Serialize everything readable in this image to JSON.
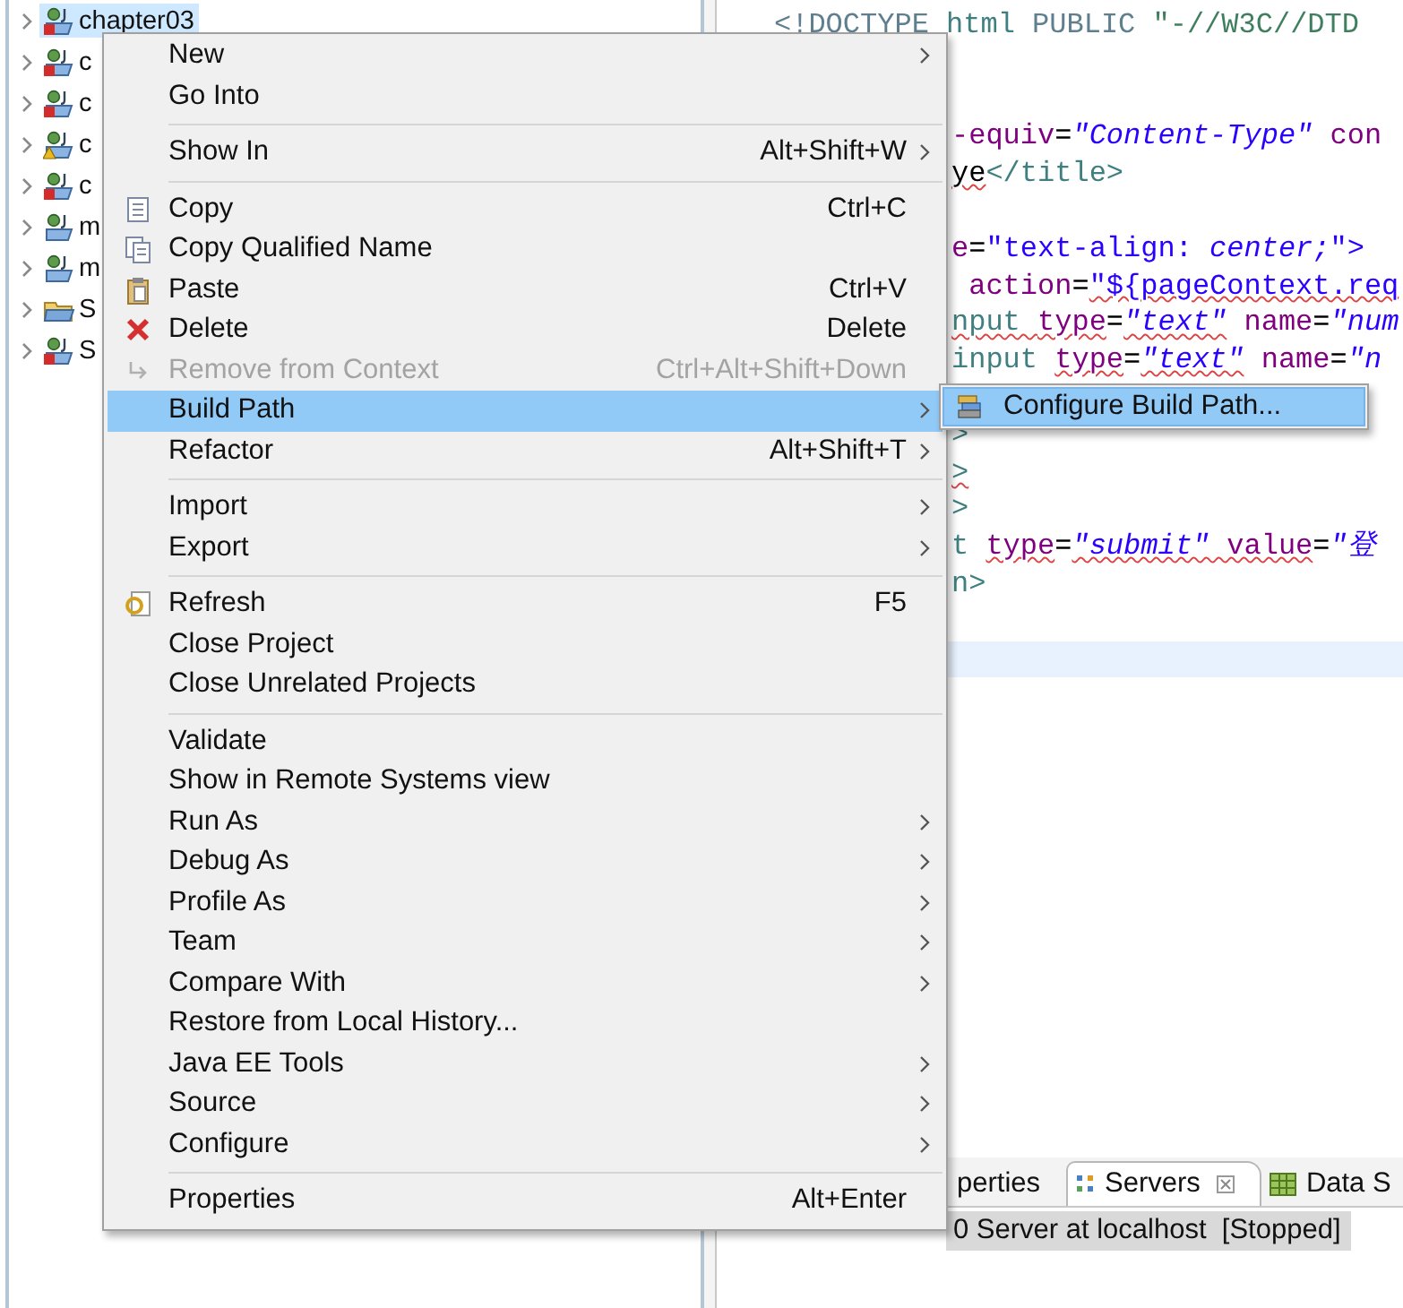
{
  "explorer": {
    "items": [
      {
        "label": "chapter03",
        "selected": true,
        "kind": "error"
      },
      {
        "label": "c",
        "selected": false,
        "kind": "error"
      },
      {
        "label": "c",
        "selected": false,
        "kind": "error"
      },
      {
        "label": "c",
        "selected": false,
        "kind": "warning"
      },
      {
        "label": "c",
        "selected": false,
        "kind": "error"
      },
      {
        "label": "m",
        "selected": false,
        "kind": "plain"
      },
      {
        "label": "m",
        "selected": false,
        "kind": "plain"
      },
      {
        "label": "S",
        "selected": false,
        "kind": "folder"
      },
      {
        "label": "S",
        "selected": false,
        "kind": "error"
      }
    ]
  },
  "editor": {
    "lines": [
      {
        "kind": "full",
        "segments": [
          {
            "t": "<!DOCTYPE",
            "kind": "decl"
          },
          {
            "t": " html ",
            "kind": "tag"
          },
          {
            "t": "PUBLIC ",
            "kind": "decl"
          },
          {
            "t": "\"-//W3C//DTD",
            "kind": "doc"
          }
        ]
      },
      {
        "kind": "hidden"
      },
      {
        "kind": "hidden"
      },
      {
        "kind": "partial",
        "segments": [
          {
            "t": "-equiv",
            "kind": "attr"
          },
          {
            "t": "=",
            "kind": "plain"
          },
          {
            "t": "\"Content-Type\"",
            "kind": "val"
          },
          {
            "t": " con",
            "kind": "attr"
          }
        ]
      },
      {
        "kind": "partial",
        "segments": [
          {
            "t": "ye",
            "kind": "plain",
            "misspelled": true
          },
          {
            "t": "</title>",
            "kind": "tag"
          }
        ]
      },
      {
        "kind": "hidden"
      },
      {
        "kind": "partial",
        "segments": [
          {
            "t": "e",
            "kind": "attr"
          },
          {
            "t": "=",
            "kind": "plain"
          },
          {
            "t": "\"text-align: ",
            "kind": "str"
          },
          {
            "t": "center;",
            "kind": "val"
          },
          {
            "t": "\">",
            "kind": "str"
          }
        ]
      },
      {
        "kind": "partial",
        "segments": [
          {
            "t": " action",
            "kind": "attr"
          },
          {
            "t": "=",
            "kind": "plain"
          },
          {
            "t": "\"${pageContext.req",
            "kind": "str",
            "misspelled": true
          }
        ]
      },
      {
        "kind": "partial",
        "segments": [
          {
            "t": "nput ",
            "kind": "tag",
            "misspelled": true
          },
          {
            "t": "type",
            "kind": "attr",
            "misspelled": true
          },
          {
            "t": "=",
            "kind": "plain"
          },
          {
            "t": "\"text\"",
            "kind": "val",
            "misspelled": true
          },
          {
            "t": " name",
            "kind": "attr"
          },
          {
            "t": "=",
            "kind": "plain"
          },
          {
            "t": "\"num",
            "kind": "val"
          }
        ]
      },
      {
        "kind": "partial",
        "segments": [
          {
            "t": "input ",
            "kind": "tag"
          },
          {
            "t": "type",
            "kind": "attr",
            "misspelled": true
          },
          {
            "t": "=",
            "kind": "plain"
          },
          {
            "t": "\"text\"",
            "kind": "val",
            "misspelled": true
          },
          {
            "t": " name",
            "kind": "attr"
          },
          {
            "t": "=",
            "kind": "plain"
          },
          {
            "t": "\"n",
            "kind": "val"
          }
        ]
      },
      {
        "kind": "hidden"
      },
      {
        "kind": "partial",
        "segments": [
          {
            "t": ">",
            "kind": "tag"
          }
        ]
      },
      {
        "kind": "partial",
        "segments": [
          {
            "t": ">",
            "kind": "tag",
            "misspelled": true
          }
        ]
      },
      {
        "kind": "partial",
        "segments": [
          {
            "t": ">",
            "kind": "tag"
          }
        ]
      },
      {
        "kind": "partial",
        "segments": [
          {
            "t": "t ",
            "kind": "tag"
          },
          {
            "t": "type",
            "kind": "attr",
            "misspelled": true
          },
          {
            "t": "=",
            "kind": "plain"
          },
          {
            "t": "\"submit\"",
            "kind": "val",
            "misspelled": true
          },
          {
            "t": " value",
            "kind": "attr",
            "misspelled": true
          },
          {
            "t": "=",
            "kind": "plain"
          },
          {
            "t": "\"登",
            "kind": "val"
          }
        ]
      },
      {
        "kind": "partial",
        "segments": [
          {
            "t": "n>",
            "kind": "tag"
          }
        ]
      },
      {
        "kind": "hidden"
      },
      {
        "kind": "current"
      }
    ]
  },
  "bottom_panel": {
    "tabs": [
      {
        "label": "perties",
        "selected": false,
        "kind": "cut"
      },
      {
        "label": "Servers",
        "selected": true,
        "kind": "servers"
      },
      {
        "label": "Data S",
        "selected": false,
        "kind": "data"
      }
    ],
    "rows": [
      {
        "label": "0 Server at localhost  [Stopped]",
        "selected": true
      }
    ]
  },
  "context_menu": {
    "groups": [
      [
        {
          "label": "New",
          "kind": "plain",
          "submenu": true,
          "disabled": false,
          "selected": false
        },
        {
          "label": "Go Into",
          "kind": "plain",
          "submenu": false,
          "disabled": false,
          "selected": false
        }
      ],
      [
        {
          "label": "Show In",
          "shortcut": "Alt+Shift+W",
          "kind": "plain",
          "submenu": true,
          "disabled": false,
          "selected": false
        }
      ],
      [
        {
          "label": "Copy",
          "shortcut": "Ctrl+C",
          "kind": "copy",
          "submenu": false,
          "disabled": false,
          "selected": false
        },
        {
          "label": "Copy Qualified Name",
          "kind": "copy-qualified",
          "submenu": false,
          "disabled": false,
          "selected": false
        },
        {
          "label": "Paste",
          "shortcut": "Ctrl+V",
          "kind": "paste",
          "submenu": false,
          "disabled": false,
          "selected": false
        },
        {
          "label": "Delete",
          "shortcut": "Delete",
          "kind": "delete",
          "submenu": false,
          "disabled": false,
          "selected": false
        },
        {
          "label": "Remove from Context",
          "shortcut": "Ctrl+Alt+Shift+Down",
          "kind": "remove",
          "submenu": false,
          "disabled": true,
          "selected": false
        },
        {
          "label": "Build Path",
          "kind": "plain",
          "submenu": true,
          "disabled": false,
          "selected": true
        },
        {
          "label": "Refactor",
          "shortcut": "Alt+Shift+T",
          "kind": "plain",
          "submenu": true,
          "disabled": false,
          "selected": false
        }
      ],
      [
        {
          "label": "Import",
          "kind": "plain",
          "submenu": true,
          "disabled": false,
          "selected": false
        },
        {
          "label": "Export",
          "kind": "plain",
          "submenu": true,
          "disabled": false,
          "selected": false
        }
      ],
      [
        {
          "label": "Refresh",
          "shortcut": "F5",
          "kind": "refresh",
          "submenu": false,
          "disabled": false,
          "selected": false
        },
        {
          "label": "Close Project",
          "kind": "plain",
          "submenu": false,
          "disabled": false,
          "selected": false
        },
        {
          "label": "Close Unrelated Projects",
          "kind": "plain",
          "submenu": false,
          "disabled": false,
          "selected": false
        }
      ],
      [
        {
          "label": "Validate",
          "kind": "plain",
          "submenu": false,
          "disabled": false,
          "selected": false
        },
        {
          "label": "Show in Remote Systems view",
          "kind": "plain",
          "submenu": false,
          "disabled": false,
          "selected": false
        },
        {
          "label": "Run As",
          "kind": "plain",
          "submenu": true,
          "disabled": false,
          "selected": false
        },
        {
          "label": "Debug As",
          "kind": "plain",
          "submenu": true,
          "disabled": false,
          "selected": false
        },
        {
          "label": "Profile As",
          "kind": "plain",
          "submenu": true,
          "disabled": false,
          "selected": false
        },
        {
          "label": "Team",
          "kind": "plain",
          "submenu": true,
          "disabled": false,
          "selected": false
        },
        {
          "label": "Compare With",
          "kind": "plain",
          "submenu": true,
          "disabled": false,
          "selected": false
        },
        {
          "label": "Restore from Local History...",
          "kind": "plain",
          "submenu": false,
          "disabled": false,
          "selected": false
        },
        {
          "label": "Java EE Tools",
          "kind": "plain",
          "submenu": true,
          "disabled": false,
          "selected": false
        },
        {
          "label": "Source",
          "kind": "plain",
          "submenu": true,
          "disabled": false,
          "selected": false
        },
        {
          "label": "Configure",
          "kind": "plain",
          "submenu": true,
          "disabled": false,
          "selected": false
        }
      ],
      [
        {
          "label": "Properties",
          "shortcut": "Alt+Enter",
          "kind": "plain",
          "submenu": false,
          "disabled": false,
          "selected": false
        }
      ]
    ]
  },
  "submenu": {
    "items": [
      {
        "label": "Configure Build Path...",
        "selected": true
      }
    ]
  }
}
